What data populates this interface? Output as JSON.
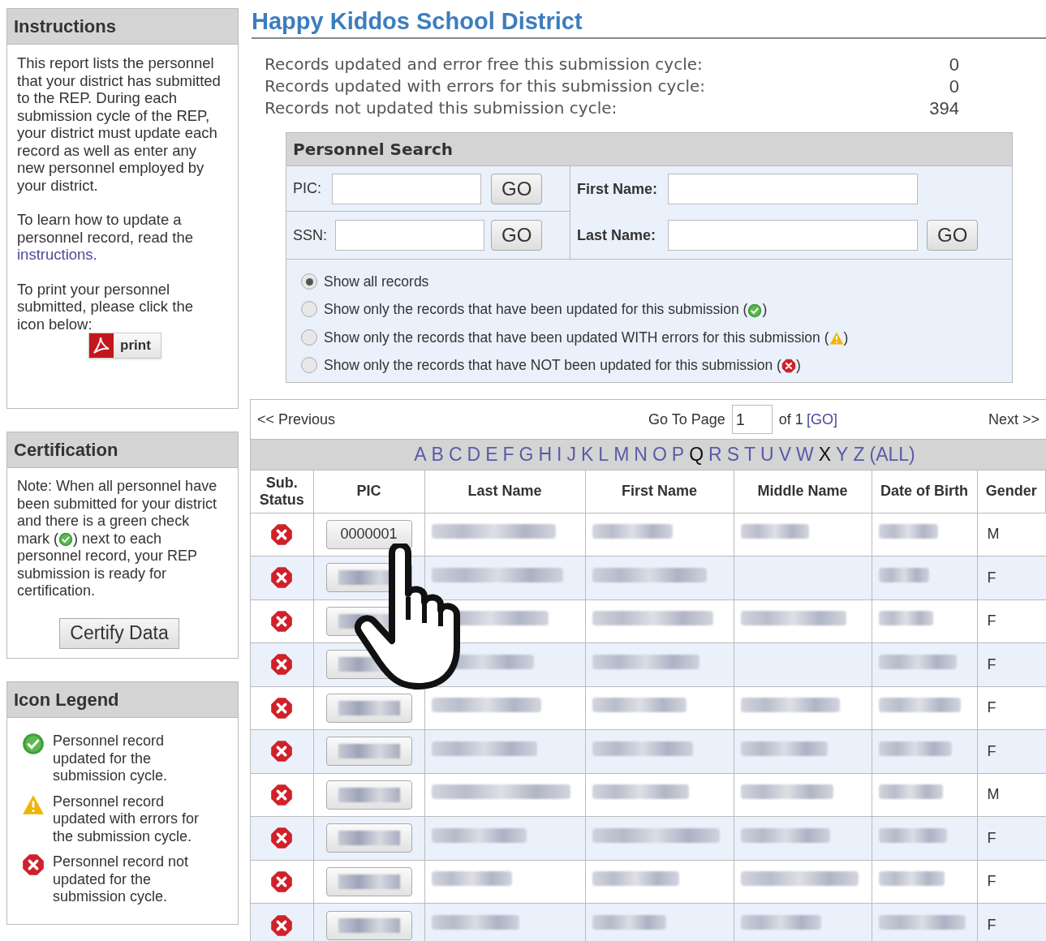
{
  "instructions": {
    "title": "Instructions",
    "paragraph_1": "This report lists the personnel that your district has submitted to the REP. During each submission cycle of the REP, your district must update each record as well as enter any new personnel employed by your district.",
    "paragraph_2": "To learn how to update a personnel record, read the",
    "paragraph_2_link": "instructions.",
    "paragraph_3": "To print your personnel submitted, please click the icon below:",
    "print_button": "print"
  },
  "certification": {
    "title": "Certification",
    "note_before": "Note: When all personnel have been submitted for your district and there is a green check mark (",
    "note": {
      "kind": "ok"
    },
    "note_after": ") next to each personnel record, your REP submission is ready for certification.",
    "button": "Certify Data"
  },
  "legend": {
    "title": "Icon Legend",
    "items": [
      {
        "kind": "ok",
        "text": "Personnel record updated for the submission cycle."
      },
      {
        "kind": "warn",
        "text": "Personnel record updated with errors for the submission cycle."
      },
      {
        "kind": "error",
        "text": "Personnel record not updated for the submission cycle."
      }
    ]
  },
  "district_title": "Happy Kiddos School District",
  "stats": [
    {
      "label": "Records updated and error free this submission cycle:",
      "value": "0"
    },
    {
      "label": "Records updated with errors for this submission cycle:",
      "value": "0"
    },
    {
      "label": "Records not updated this submission cycle:",
      "value": "394"
    }
  ],
  "search": {
    "title": "Personnel Search",
    "pic_label": "PIC:",
    "ssn_label": "SSN:",
    "first_name_label": "First Name:",
    "last_name_label": "Last Name:",
    "go_buttons": [
      "GO",
      "GO",
      "GO"
    ],
    "options": [
      {
        "kind": "plain",
        "label": "Show all records",
        "selected": true
      },
      {
        "kind": "ok",
        "label": "Show only the records that have been updated for this submission (",
        "label_end": ")",
        "selected": false
      },
      {
        "kind": "warn",
        "label": "Show only the records that have been updated WITH errors for this submission (",
        "label_end": ")",
        "selected": false
      },
      {
        "kind": "error",
        "label": "Show only the records that have NOT been updated for this submission (",
        "label_end": ")",
        "selected": false
      }
    ]
  },
  "pager": {
    "previous": "<< Previous",
    "go_to_label": "Go To Page",
    "page": "1",
    "of_label": "of 1",
    "go_link": "[GO]",
    "next": "Next >>"
  },
  "letters": [
    {
      "label": "A",
      "disabled": false
    },
    {
      "label": "B",
      "disabled": false
    },
    {
      "label": "C",
      "disabled": false
    },
    {
      "label": "D",
      "disabled": false
    },
    {
      "label": "E",
      "disabled": false
    },
    {
      "label": "F",
      "disabled": false
    },
    {
      "label": "G",
      "disabled": false
    },
    {
      "label": "H",
      "disabled": false
    },
    {
      "label": "I",
      "disabled": false
    },
    {
      "label": "J",
      "disabled": false
    },
    {
      "label": "K",
      "disabled": false
    },
    {
      "label": "L",
      "disabled": false
    },
    {
      "label": "M",
      "disabled": false
    },
    {
      "label": "N",
      "disabled": false
    },
    {
      "label": "O",
      "disabled": false
    },
    {
      "label": "P",
      "disabled": false
    },
    {
      "label": "Q",
      "disabled": true
    },
    {
      "label": "R",
      "disabled": false
    },
    {
      "label": "S",
      "disabled": false
    },
    {
      "label": "T",
      "disabled": false
    },
    {
      "label": "U",
      "disabled": false
    },
    {
      "label": "V",
      "disabled": false
    },
    {
      "label": "W",
      "disabled": false
    },
    {
      "label": "X",
      "disabled": true
    },
    {
      "label": "Y",
      "disabled": false
    },
    {
      "label": "Z",
      "disabled": false
    },
    {
      "label": "(ALL)",
      "disabled": false
    }
  ],
  "table": {
    "columns": [
      "Sub. Status",
      "PIC",
      "Last Name",
      "First Name",
      "Middle Name",
      "Date of Birth",
      "Gender"
    ],
    "rows": [
      {
        "kind": "error",
        "pic": {
          "kind": "text",
          "text": "0000001"
        },
        "last_name": {
          "kind": "blurred"
        },
        "first_name": {
          "kind": "blurred"
        },
        "middle_name": {
          "kind": "blurred"
        },
        "date_of_birth": {
          "kind": "blurred"
        },
        "gender": "M"
      },
      {
        "kind": "error",
        "pic": {
          "kind": "blurred"
        },
        "last_name": {
          "kind": "blurred"
        },
        "first_name": {
          "kind": "blurred"
        },
        "middle_name": {
          "kind": "empty"
        },
        "date_of_birth": {
          "kind": "blurred"
        },
        "gender": "F"
      },
      {
        "kind": "error",
        "pic": {
          "kind": "blurred"
        },
        "last_name": {
          "kind": "blurred"
        },
        "first_name": {
          "kind": "blurred"
        },
        "middle_name": {
          "kind": "blurred"
        },
        "date_of_birth": {
          "kind": "blurred"
        },
        "gender": "F"
      },
      {
        "kind": "error",
        "pic": {
          "kind": "blurred"
        },
        "last_name": {
          "kind": "blurred"
        },
        "first_name": {
          "kind": "blurred"
        },
        "middle_name": {
          "kind": "empty"
        },
        "date_of_birth": {
          "kind": "blurred"
        },
        "gender": "F"
      },
      {
        "kind": "error",
        "pic": {
          "kind": "blurred"
        },
        "last_name": {
          "kind": "blurred"
        },
        "first_name": {
          "kind": "blurred"
        },
        "middle_name": {
          "kind": "blurred"
        },
        "date_of_birth": {
          "kind": "blurred"
        },
        "gender": "F"
      },
      {
        "kind": "error",
        "pic": {
          "kind": "blurred"
        },
        "last_name": {
          "kind": "blurred"
        },
        "first_name": {
          "kind": "blurred"
        },
        "middle_name": {
          "kind": "blurred"
        },
        "date_of_birth": {
          "kind": "blurred"
        },
        "gender": "F"
      },
      {
        "kind": "error",
        "pic": {
          "kind": "blurred"
        },
        "last_name": {
          "kind": "blurred"
        },
        "first_name": {
          "kind": "blurred"
        },
        "middle_name": {
          "kind": "blurred"
        },
        "date_of_birth": {
          "kind": "blurred"
        },
        "gender": "M"
      },
      {
        "kind": "error",
        "pic": {
          "kind": "blurred"
        },
        "last_name": {
          "kind": "blurred"
        },
        "first_name": {
          "kind": "blurred"
        },
        "middle_name": {
          "kind": "blurred"
        },
        "date_of_birth": {
          "kind": "blurred"
        },
        "gender": "F"
      },
      {
        "kind": "error",
        "pic": {
          "kind": "blurred"
        },
        "last_name": {
          "kind": "blurred"
        },
        "first_name": {
          "kind": "blurred"
        },
        "middle_name": {
          "kind": "blurred"
        },
        "date_of_birth": {
          "kind": "blurred"
        },
        "gender": "F"
      },
      {
        "kind": "error",
        "pic": {
          "kind": "blurred"
        },
        "last_name": {
          "kind": "blurred"
        },
        "first_name": {
          "kind": "blurred"
        },
        "middle_name": {
          "kind": "blurred"
        },
        "date_of_birth": {
          "kind": "blurred"
        },
        "gender": "F"
      }
    ]
  }
}
